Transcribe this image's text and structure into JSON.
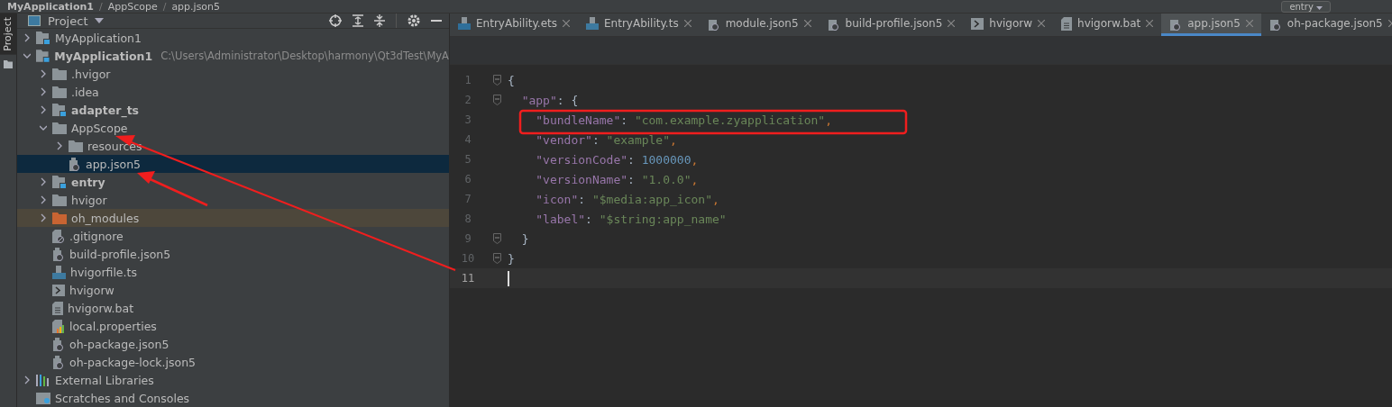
{
  "breadcrumb": [
    {
      "text": "MyApplication1",
      "kind": "crumb"
    },
    {
      "text": "/",
      "kind": "separator"
    },
    {
      "text": "AppScope",
      "kind": "crumb"
    },
    {
      "text": "/",
      "kind": "separator"
    },
    {
      "text": "app.json5",
      "kind": "crumb"
    }
  ],
  "run_config": {
    "label": "entry"
  },
  "panel": {
    "title": "Project",
    "vertical_tab": "Project"
  },
  "tree": [
    {
      "label": "MyApplication1",
      "kind": "module",
      "bold": false,
      "expanded": false,
      "selected": false,
      "excluded": false
    },
    {
      "label": "MyApplication1",
      "hint": "C:\\Users\\Administrator\\Desktop\\harmony\\Qt3dTest\\MyA",
      "kind": "module",
      "bold": true,
      "expanded": true,
      "selected": false,
      "excluded": false,
      "children": [
        {
          "label": ".hvigor",
          "kind": "folder",
          "bold": false,
          "expanded": false,
          "selected": false,
          "excluded": false
        },
        {
          "label": ".idea",
          "kind": "folder",
          "bold": false,
          "expanded": false,
          "selected": false,
          "excluded": false
        },
        {
          "label": "adapter_ts",
          "kind": "module",
          "bold": true,
          "expanded": false,
          "selected": false,
          "excluded": false
        },
        {
          "label": "AppScope",
          "kind": "folder",
          "bold": false,
          "expanded": true,
          "selected": false,
          "excluded": false,
          "children": [
            {
              "label": "resources",
              "kind": "folder",
              "bold": false,
              "expanded": false,
              "selected": false,
              "excluded": false
            },
            {
              "label": "app.json5",
              "kind": "json",
              "bold": false,
              "selected": true,
              "excluded": false
            }
          ]
        },
        {
          "label": "entry",
          "kind": "module",
          "bold": true,
          "expanded": false,
          "selected": false,
          "excluded": false
        },
        {
          "label": "hvigor",
          "kind": "folder",
          "bold": false,
          "expanded": false,
          "selected": false,
          "excluded": false
        },
        {
          "label": "oh_modules",
          "kind": "folder",
          "bold": false,
          "expanded": false,
          "selected": false,
          "excluded": true
        },
        {
          "label": ".gitignore",
          "kind": "ignore",
          "bold": false,
          "selected": false,
          "excluded": false
        },
        {
          "label": "build-profile.json5",
          "kind": "json",
          "bold": false,
          "selected": false,
          "excluded": false
        },
        {
          "label": "hvigorfile.ts",
          "kind": "ts",
          "bold": false,
          "selected": false,
          "excluded": false
        },
        {
          "label": "hvigorw",
          "kind": "script",
          "bold": false,
          "selected": false,
          "excluded": false
        },
        {
          "label": "hvigorw.bat",
          "kind": "text",
          "bold": false,
          "selected": false,
          "excluded": false
        },
        {
          "label": "local.properties",
          "kind": "properties",
          "bold": false,
          "selected": false,
          "excluded": false
        },
        {
          "label": "oh-package.json5",
          "kind": "json",
          "bold": false,
          "selected": false,
          "excluded": false
        },
        {
          "label": "oh-package-lock.json5",
          "kind": "json",
          "bold": false,
          "selected": false,
          "excluded": false
        }
      ]
    },
    {
      "label": "External Libraries",
      "kind": "library",
      "bold": false,
      "expanded": false,
      "selected": false,
      "excluded": false
    },
    {
      "label": "Scratches and Consoles",
      "kind": "scratch",
      "bold": false,
      "selected": false,
      "excluded": false
    }
  ],
  "tabs": [
    {
      "label": "EntryAbility.ets",
      "kind": "ets",
      "selected": false
    },
    {
      "label": "EntryAbility.ts",
      "kind": "ts",
      "selected": false
    },
    {
      "label": "module.json5",
      "kind": "json",
      "selected": false
    },
    {
      "label": "build-profile.json5",
      "kind": "json",
      "selected": false
    },
    {
      "label": "hvigorw",
      "kind": "script",
      "selected": false
    },
    {
      "label": "hvigorw.bat",
      "kind": "text",
      "selected": false
    },
    {
      "label": "app.json5",
      "kind": "json",
      "selected": true
    },
    {
      "label": "oh-package.json5",
      "kind": "json",
      "selected": false
    }
  ],
  "code": [
    {
      "number": "1",
      "kind": "root",
      "fold": true,
      "current": false,
      "tokens": [
        {
          "text": "{",
          "kind": "punct"
        }
      ]
    },
    {
      "number": "2",
      "kind": "block",
      "fold": true,
      "current": false,
      "tokens": [
        {
          "text": "\"app\"",
          "kind": "key"
        },
        {
          "text": ": {",
          "kind": "punct"
        }
      ]
    },
    {
      "number": "3",
      "kind": "entry",
      "fold": false,
      "current": false,
      "tokens": [
        {
          "text": "\"bundleName\"",
          "kind": "key"
        },
        {
          "text": ": ",
          "kind": "punct"
        },
        {
          "text": "\"com.example.zyapplication\"",
          "kind": "string"
        },
        {
          "text": ",",
          "kind": "comma"
        }
      ]
    },
    {
      "number": "4",
      "kind": "entry",
      "fold": false,
      "current": false,
      "tokens": [
        {
          "text": "\"vendor\"",
          "kind": "key"
        },
        {
          "text": ": ",
          "kind": "punct"
        },
        {
          "text": "\"example\"",
          "kind": "string"
        },
        {
          "text": ",",
          "kind": "comma"
        }
      ]
    },
    {
      "number": "5",
      "kind": "entry",
      "fold": false,
      "current": false,
      "tokens": [
        {
          "text": "\"versionCode\"",
          "kind": "key"
        },
        {
          "text": ": ",
          "kind": "punct"
        },
        {
          "text": "1000000",
          "kind": "number"
        },
        {
          "text": ",",
          "kind": "comma"
        }
      ]
    },
    {
      "number": "6",
      "kind": "entry",
      "fold": false,
      "current": false,
      "tokens": [
        {
          "text": "\"versionName\"",
          "kind": "key"
        },
        {
          "text": ": ",
          "kind": "punct"
        },
        {
          "text": "\"1.0.0\"",
          "kind": "string"
        },
        {
          "text": ",",
          "kind": "comma"
        }
      ]
    },
    {
      "number": "7",
      "kind": "entry",
      "fold": false,
      "current": false,
      "tokens": [
        {
          "text": "\"icon\"",
          "kind": "key"
        },
        {
          "text": ": ",
          "kind": "punct"
        },
        {
          "text": "\"$media:app_icon\"",
          "kind": "string"
        },
        {
          "text": ",",
          "kind": "comma"
        }
      ]
    },
    {
      "number": "8",
      "kind": "entry",
      "fold": false,
      "current": false,
      "tokens": [
        {
          "text": "\"label\"",
          "kind": "key"
        },
        {
          "text": ": ",
          "kind": "punct"
        },
        {
          "text": "\"$string:app_name\"",
          "kind": "string"
        }
      ]
    },
    {
      "number": "9",
      "kind": "block",
      "fold": true,
      "current": false,
      "tokens": [
        {
          "text": "}",
          "kind": "punct"
        }
      ]
    },
    {
      "number": "10",
      "kind": "root",
      "fold": true,
      "current": false,
      "tokens": [
        {
          "text": "}",
          "kind": "punct"
        }
      ]
    },
    {
      "number": "11",
      "fold": false,
      "current": true
    }
  ]
}
